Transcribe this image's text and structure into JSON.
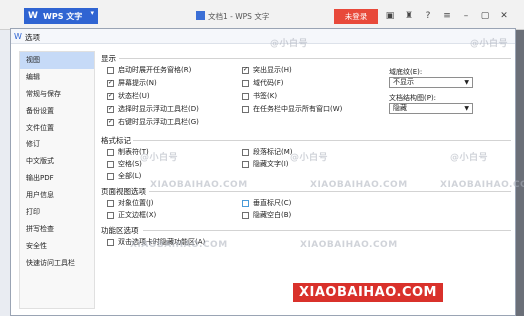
{
  "app": {
    "name": "WPS 文字",
    "doc_title": "文档1 - WPS 文字",
    "login_label": "未登录"
  },
  "dialog": {
    "title": "选项"
  },
  "nav": {
    "items": [
      "视图",
      "编辑",
      "常规与保存",
      "备份设置",
      "文件位置",
      "修订",
      "中文版式",
      "输出PDF",
      "用户信息",
      "打印",
      "拼写检查",
      "安全性",
      "快速访问工具栏"
    ]
  },
  "display": {
    "title": "显示",
    "options": [
      {
        "label": "启动时展开任务窗格(R)",
        "checked": false
      },
      {
        "label": "屏幕提示(N)",
        "checked": true
      },
      {
        "label": "状态栏(U)",
        "checked": true
      },
      {
        "label": "选择时显示浮动工具栏(D)",
        "checked": true
      },
      {
        "label": "右键时显示浮动工具栏(G)",
        "checked": true
      },
      {
        "label": "突出显示(H)",
        "checked": true
      },
      {
        "label": "域代码(F)",
        "checked": false
      },
      {
        "label": "书签(K)",
        "checked": false
      },
      {
        "label": "在任务栏中显示所有窗口(W)",
        "checked": false
      }
    ],
    "shading_label": "域底纹(E):",
    "shading_value": "不显示",
    "docmap_label": "文档结构图(P):",
    "docmap_value": "隐藏"
  },
  "format_marks": {
    "title": "格式标记",
    "options": [
      {
        "label": "制表符(T)",
        "checked": false
      },
      {
        "label": "空格(S)",
        "checked": false
      },
      {
        "label": "全部(L)",
        "checked": false
      },
      {
        "label": "段落标记(M)",
        "checked": false
      },
      {
        "label": "隐藏文字(I)",
        "checked": false
      }
    ]
  },
  "page_view": {
    "title": "页面视图选项",
    "options": [
      {
        "label": "对象位置(J)",
        "checked": false
      },
      {
        "label": "正文边框(X)",
        "checked": false
      },
      {
        "label": "垂直标尺(C)",
        "checked": false
      },
      {
        "label": "隐藏空白(B)",
        "checked": false
      }
    ]
  },
  "ribbon": {
    "title": "功能区选项",
    "options": [
      {
        "label": "双击选项卡时隐藏功能区(A)",
        "checked": false
      }
    ]
  },
  "watermark": {
    "brand": "@小白号",
    "site": "XIAOBAIHAO.COM",
    "footer_name": "小白号",
    "footer_site": "XIAOBAIHAO.COM"
  }
}
